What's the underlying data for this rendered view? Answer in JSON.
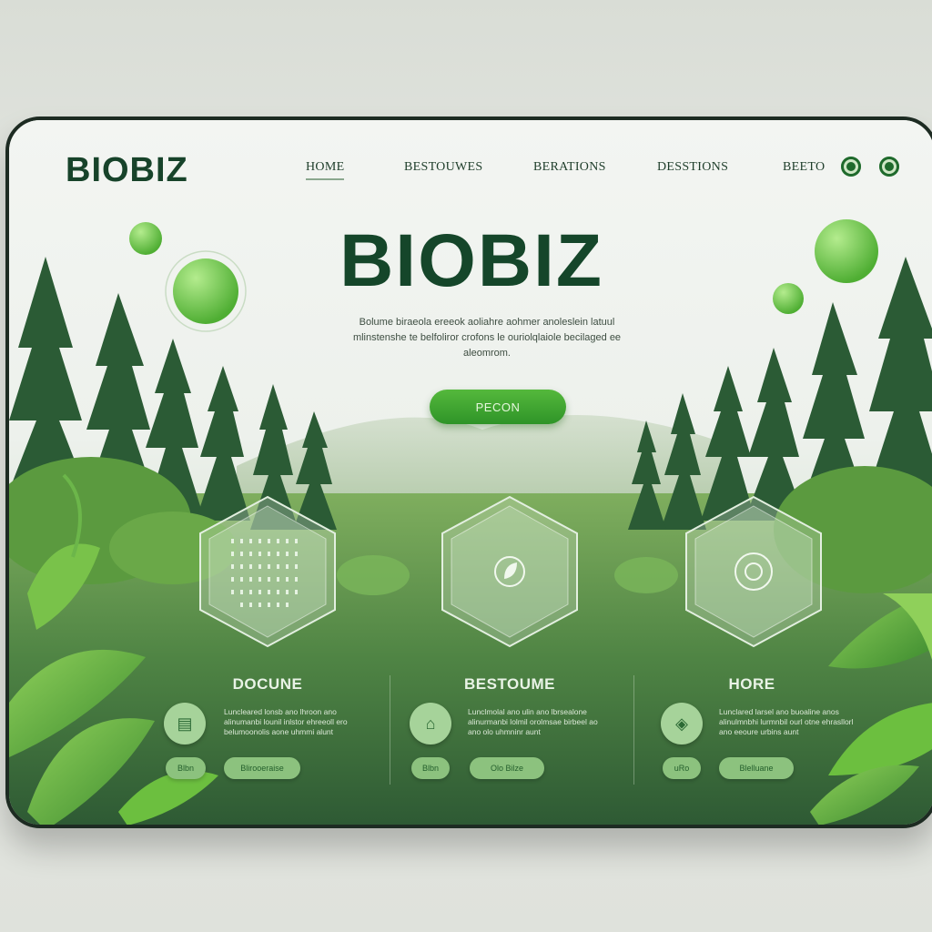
{
  "brand": {
    "logo": "BIOBIZ"
  },
  "nav": {
    "items": [
      "HOME",
      "BESTOUWES",
      "BERATIONS",
      "DESSTIONS",
      "BEETO"
    ],
    "active": "HOME"
  },
  "hero": {
    "title": "BIOBIZ",
    "description": "Bolume biraeola ereeok aoliahre aohmer anoleslein latuul mlinstenshe te belfoliror crofons le ouriolqlaiole becilaged ee aleomrom.",
    "cta_label": "PECON"
  },
  "cards": [
    {
      "title": "DOCUNE",
      "icon": "grid-dots-icon",
      "button_icon": "document-icon",
      "text": "Luncleared lonsb ano lhroon ano alinumanbi lounil inlstor ehreeoll ero belumoonolis aone uhmmi alunt",
      "pill_label": "Blbn",
      "pill2_label": "Blirooeraise"
    },
    {
      "title": "BESTOUME",
      "icon": "leaf-badge-icon",
      "button_icon": "plant-icon",
      "text": "Lunclmolal ano ulin ano lbrsealone alinurmanbi lolmil orolmsae birbeel ao ano olo uhmninr aunt",
      "pill_label": "Blbn",
      "pill2_label": "Olo Bilze"
    },
    {
      "title": "HORE",
      "icon": "target-circle-icon",
      "button_icon": "tag-icon",
      "text": "Lunclared larsel ano buoaline anos alinulmnbhi lurmnbil ourl otne ehrasllorl ano eeoure urbins aunt",
      "pill_label": "uRo",
      "pill2_label": "Blelluane"
    }
  ],
  "colors": {
    "brand_green": "#15462a",
    "accent": "#3aa52e",
    "pill": "#8cc27e"
  }
}
